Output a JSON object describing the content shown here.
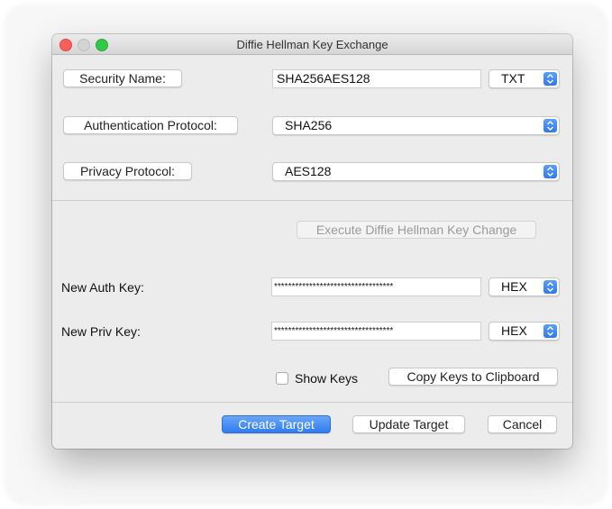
{
  "window": {
    "title": "Diffie Hellman Key Exchange"
  },
  "security": {
    "name_button": "Security Name:",
    "name_value": "SHA256AES128",
    "format_value": "TXT"
  },
  "auth": {
    "button": "Authentication Protocol:",
    "value": "SHA256"
  },
  "privacy": {
    "button": "Privacy Protocol:",
    "value": "AES128"
  },
  "execute_button": "Execute Diffie Hellman Key Change",
  "new_auth": {
    "label": "New Auth Key:",
    "value": "**********************************",
    "format_value": "HEX"
  },
  "new_priv": {
    "label": "New Priv Key:",
    "value": "**********************************",
    "format_value": "HEX"
  },
  "show_keys_label": "Show Keys",
  "show_keys_checked": false,
  "copy_button": "Copy Keys to Clipboard",
  "footer": {
    "create": "Create Target",
    "update": "Update Target",
    "cancel": "Cancel"
  },
  "colors": {
    "primary_button": "#2f7cf0",
    "close_light": "#fc605b",
    "zoom_light": "#34c84a"
  }
}
